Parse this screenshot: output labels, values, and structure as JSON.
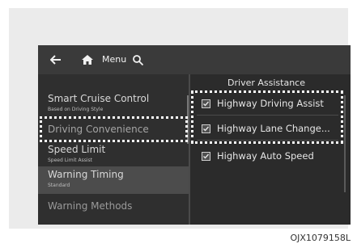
{
  "topbar": {
    "back_icon": "arrow-left-icon",
    "home_icon": "home-icon",
    "menu_label": "Menu",
    "search_icon": "search-icon"
  },
  "left_menu": {
    "items": [
      {
        "label": "Smart Cruise Control",
        "sub": "Based on Driving Style"
      },
      {
        "label": "Driving Convenience",
        "sub": ""
      },
      {
        "label": "Speed Limit",
        "sub": "Speed Limit Assist"
      },
      {
        "label": "Warning Timing",
        "sub": "Standard"
      },
      {
        "label": "Warning Methods",
        "sub": ""
      }
    ]
  },
  "right_panel": {
    "title": "Driver Assistance",
    "options": [
      {
        "label": "Highway Driving Assist",
        "checked": true
      },
      {
        "label": "Highway Lane Change...",
        "checked": true
      },
      {
        "label": "Highway Auto Speed",
        "checked": true
      }
    ]
  },
  "caption": "OJX1079158L",
  "colors": {
    "screen_bg": "#2e2e2e",
    "highlight_border": "#ffffff",
    "outer_frame": "#ebebeb"
  }
}
